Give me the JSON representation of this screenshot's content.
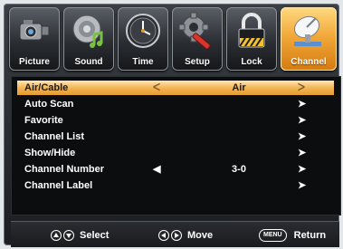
{
  "tabs": [
    {
      "label": "Picture",
      "icon": "camera-icon",
      "active": false
    },
    {
      "label": "Sound",
      "icon": "speaker-icon",
      "active": false
    },
    {
      "label": "Time",
      "icon": "clock-icon",
      "active": false
    },
    {
      "label": "Setup",
      "icon": "wrench-icon",
      "active": false
    },
    {
      "label": "Lock",
      "icon": "lock-icon",
      "active": false
    },
    {
      "label": "Channel",
      "icon": "satellite-dish-icon",
      "active": true
    }
  ],
  "menu": {
    "rows": [
      {
        "label": "Air/Cable",
        "left_arrow": "ᐸ",
        "value": "Air",
        "right_arrow": "ᐳ",
        "selected": true
      },
      {
        "label": "Auto Scan",
        "left_arrow": "",
        "value": "",
        "right_arrow": "➤",
        "selected": false
      },
      {
        "label": "Favorite",
        "left_arrow": "",
        "value": "",
        "right_arrow": "➤",
        "selected": false
      },
      {
        "label": "Channel List",
        "left_arrow": "",
        "value": "",
        "right_arrow": "➤",
        "selected": false
      },
      {
        "label": "Show/Hide",
        "left_arrow": "",
        "value": "",
        "right_arrow": "➤",
        "selected": false
      },
      {
        "label": "Channel Number",
        "left_arrow": "◀",
        "value": "3-0",
        "right_arrow": "➤",
        "selected": false
      },
      {
        "label": "Channel Label",
        "left_arrow": "",
        "value": "",
        "right_arrow": "➤",
        "selected": false
      }
    ]
  },
  "footer": {
    "select_label": "Select",
    "move_label": "Move",
    "menu_key": "MENU",
    "return_label": "Return"
  },
  "colors": {
    "accent": "#f2a93a",
    "highlight_row": "#f4b556",
    "panel_bg": "#0c0d0f"
  }
}
